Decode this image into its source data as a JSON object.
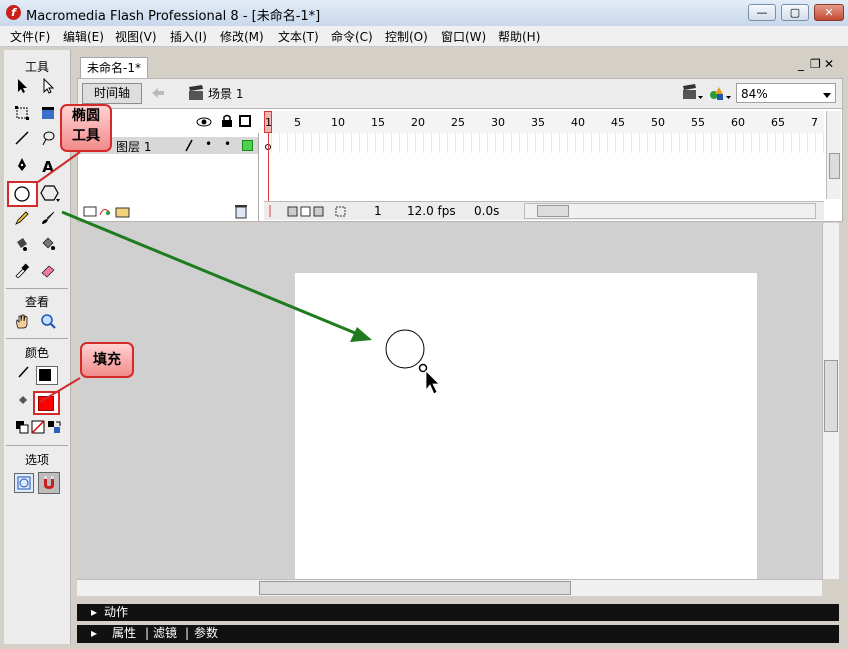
{
  "window": {
    "title": "Macromedia Flash Professional 8 - [未命名-1*]",
    "app_icon_letter": "f",
    "controls": {
      "minimize": "—",
      "maximize": "▢",
      "close": "✕"
    }
  },
  "menu": [
    "文件(F)",
    "编辑(E)",
    "视图(V)",
    "插入(I)",
    "修改(M)",
    "文本(T)",
    "命令(C)",
    "控制(O)",
    "窗口(W)",
    "帮助(H)"
  ],
  "toolbox": {
    "sections": {
      "tools": "工具",
      "view": "查看",
      "colors": "颜色",
      "options": "选项"
    }
  },
  "document": {
    "tab_label": "未命名-1*",
    "doc_controls": {
      "minimize": "_",
      "restore": "❐",
      "close": "✕"
    },
    "timeline_button": "时间轴",
    "scene_label": "场景 1",
    "zoom": "84%"
  },
  "timeline": {
    "frame_numbers": [
      "1",
      "5",
      "10",
      "15",
      "20",
      "25",
      "30",
      "35",
      "40",
      "45",
      "50",
      "55",
      "60",
      "65",
      "7"
    ],
    "layer_name": "图层 1",
    "current_frame": "1",
    "fps": "12.0 fps",
    "time": "0.0s"
  },
  "panels": {
    "actions": "动作",
    "properties": "属性",
    "filters": "滤镜",
    "params": "参数",
    "separator": "|"
  },
  "callouts": {
    "oval_tool_line1": "椭圆",
    "oval_tool_line2": "工具",
    "fill": "填充"
  },
  "colors": {
    "callout_border": "#d42a2a",
    "arrow": "#1e7b1e",
    "stroke_swatch": "#000000",
    "fill_swatch": "#ff0000",
    "playhead": "#e23b3b"
  }
}
